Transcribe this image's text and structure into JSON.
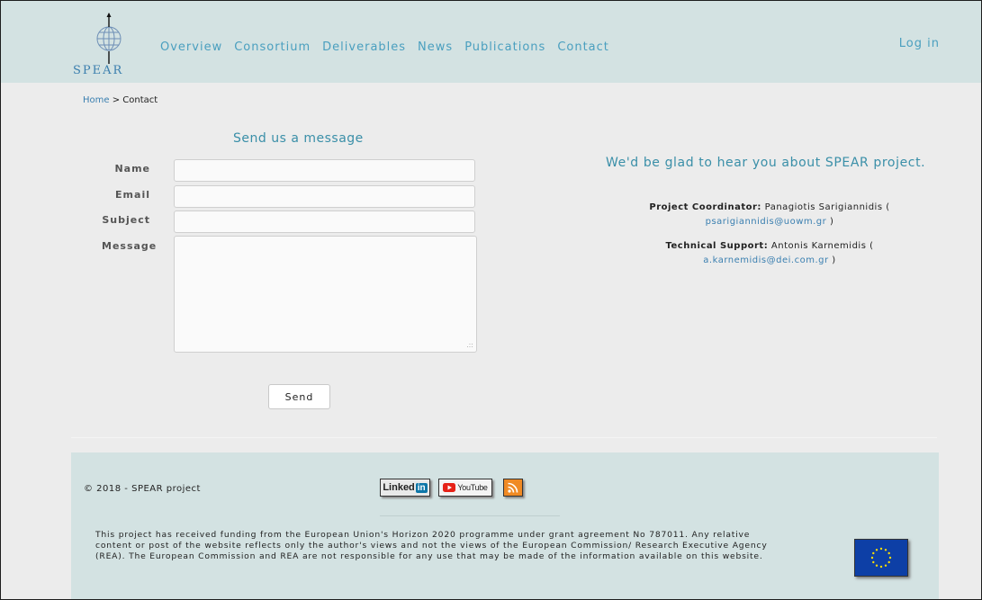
{
  "header": {
    "logo_text": "SPEAR",
    "nav": [
      "Overview",
      "Consortium",
      "Deliverables",
      "News",
      "Publications",
      "Contact"
    ],
    "login": "Log in"
  },
  "breadcrumb": {
    "home": "Home",
    "separator": " > ",
    "current": "Contact"
  },
  "form": {
    "title": "Send us a message",
    "labels": {
      "name": "Name",
      "email": "Email",
      "subject": "Subject",
      "message": "Message"
    },
    "values": {
      "name": "",
      "email": "",
      "subject": "",
      "message": ""
    },
    "send_label": "Send"
  },
  "info": {
    "glad": "We'd be glad to hear you about SPEAR project.",
    "coordinator_label": "Project Coordinator:",
    "coordinator_name": "Panagiotis Sarigiannidis (",
    "coordinator_email": "psarigiannidis@uowm.gr",
    "coordinator_close": " )",
    "support_label": "Technical Support:",
    "support_name": "Antonis Karnemidis (",
    "support_email": "a.karnemidis@dei.com.gr",
    "support_close": " )"
  },
  "footer": {
    "copyright": "© 2018 - SPEAR project",
    "linkedin_text": "Linked",
    "linkedin_in": "in",
    "youtube_text": "YouTube",
    "funding": "This project has received funding from the European Union's Horizon 2020 programme under grant agreement No 787011. Any relative content or post of the website reflects only the author's views and not the views of the European Commission/ Research Executive Agency (REA). The European Commission and REA are not responsible for any use that may be made of the information available on this website."
  },
  "icons": [
    "globe-logo-icon",
    "linkedin-icon",
    "youtube-icon",
    "rss-icon",
    "eu-flag-icon",
    "resize-grip-icon"
  ],
  "colors": {
    "header_bg": "#d3e2e2",
    "link": "#4a9fbf",
    "page_bg": "#ececec",
    "eu_blue": "#0d3fa6",
    "eu_star": "#ffdd00",
    "rss_orange": "#f08a24"
  }
}
